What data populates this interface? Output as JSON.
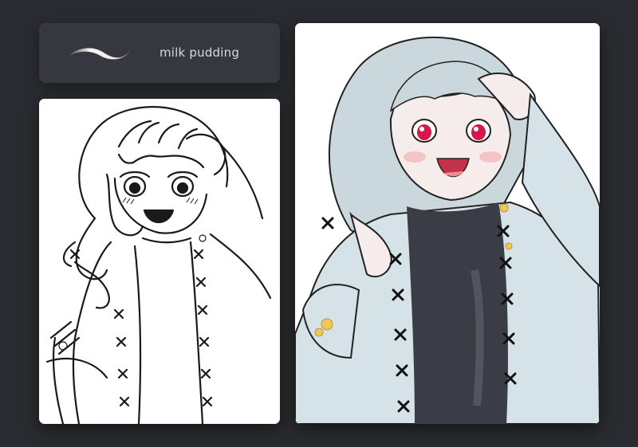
{
  "brush": {
    "name": "milk pudding",
    "icon": "brush-stroke-icon"
  },
  "panels": {
    "lineart": {
      "label": "lineart-preview"
    },
    "colored": {
      "label": "colored-preview"
    }
  },
  "colors": {
    "background": "#2a2b30",
    "card": "#37383f",
    "hair": "#c9d7dc",
    "cardigan": "#d6e2e6",
    "sweater": "#3b3d46",
    "eyes": "#d4184a",
    "blush": "#f2b9bd",
    "flower": "#f0c85a"
  }
}
